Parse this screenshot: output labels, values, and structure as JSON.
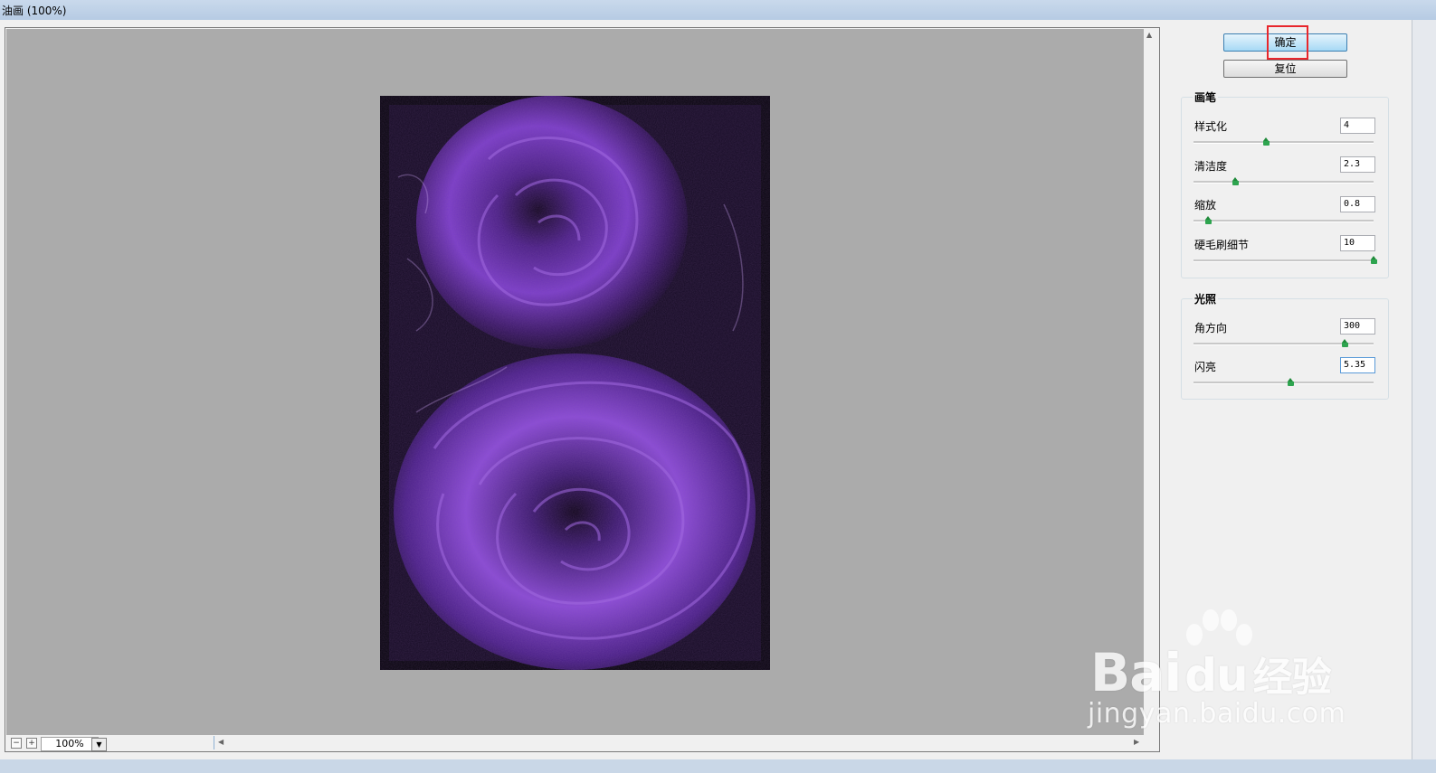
{
  "window": {
    "title": "油画 (100%)"
  },
  "preview": {
    "zoom_value": "100%",
    "zoom_out_label": "−",
    "zoom_in_label": "+"
  },
  "buttons": {
    "ok": "确定",
    "reset": "复位"
  },
  "brush": {
    "title": "画笔",
    "params": [
      {
        "label": "样式化",
        "value": "4",
        "level": 0.4
      },
      {
        "label": "清洁度",
        "value": "2.3",
        "level": 0.23
      },
      {
        "label": "缩放",
        "value": "0.8",
        "level": 0.08
      },
      {
        "label": "硬毛刷细节",
        "value": "10",
        "level": 1.0
      }
    ]
  },
  "lighting": {
    "title": "光照",
    "params": [
      {
        "label": "角方向",
        "value": "300",
        "level": 0.84
      },
      {
        "label": "闪亮",
        "value": "5.35",
        "level": 0.54
      }
    ]
  },
  "watermark": {
    "brand": "Bai",
    "brand_cn": "经验",
    "url": "jingyan.baidu.com"
  },
  "colors": {
    "highlight_box": "#e8262c",
    "slider_thumb": "#2ea44f",
    "rose_purple": "#7a3cc8"
  },
  "icons": {
    "scroll_up": "scroll-up-arrow-icon",
    "scroll_left": "scroll-left-arrow-icon",
    "scroll_right": "scroll-right-arrow-icon",
    "zoom_dropdown": "chevron-down-icon"
  }
}
